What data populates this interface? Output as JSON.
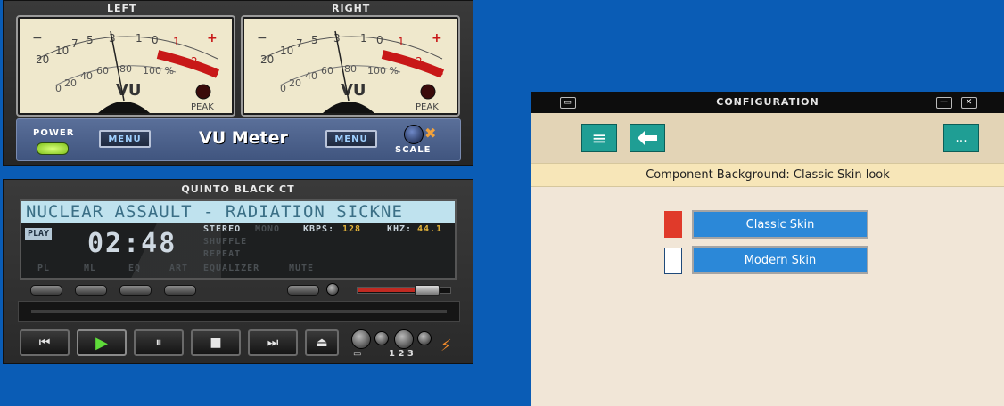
{
  "vu_meter": {
    "left_label": "LEFT",
    "right_label": "RIGHT",
    "scale_top": [
      "20",
      "10",
      "7",
      "5",
      "3",
      "1",
      "0",
      "1",
      "2",
      "3"
    ],
    "minus_sign": "−",
    "plus_sign": "+",
    "scale_bottom": [
      "0",
      "20",
      "40",
      "60",
      "80",
      "100 %"
    ],
    "vu_mark": "VU",
    "peak_label": "PEAK",
    "power_label": "POWER",
    "menu_left": "MENU",
    "title": "VU Meter",
    "menu_right": "MENU",
    "scale_label": "SCALE",
    "scale_icon": "x-icon",
    "colors": {
      "panel": "#4b5f8a",
      "power_led": "#9be03a",
      "red_zone": "#c81818"
    }
  },
  "player": {
    "title": "QUINTO BLACK CT",
    "track_text": "NUCLEAR ASSAULT - RADIATION SICKNE",
    "status": "PLAY",
    "time": "02:48",
    "stereo": "STEREO",
    "mono": "MONO",
    "shuffle": "SHUFFLE",
    "repeat": "REPEAT",
    "kbps_label": "KBPS:",
    "kbps_value": "128",
    "khz_label": "KHZ:",
    "khz_value": "44.1",
    "bottom_labels": [
      "PL",
      "ML",
      "EQ",
      "ART",
      "EQUALIZER",
      "MUTE"
    ],
    "volume_fraction": 0.62,
    "transport": {
      "prev": "⏮",
      "play": "▶",
      "pause": "⏸",
      "stop": "■",
      "next": "⏭",
      "eject": "⏏"
    },
    "preset_labels": "1 2 3",
    "lightning_icon": "lightning-icon"
  },
  "config": {
    "title": "CONFIGURATION",
    "menu_icon": "≡",
    "back_icon": "🡐",
    "more_icon": "...",
    "minimize_icon": "—",
    "close_icon": "✕",
    "status": "Component Background: Classic Skin look",
    "classic_skin": "Classic Skin",
    "modern_skin": "Modern Skin",
    "colors": {
      "accent": "#2b88d8",
      "toolbar_btn": "#1f9e94",
      "classic_swatch": "#e03a2a"
    }
  }
}
